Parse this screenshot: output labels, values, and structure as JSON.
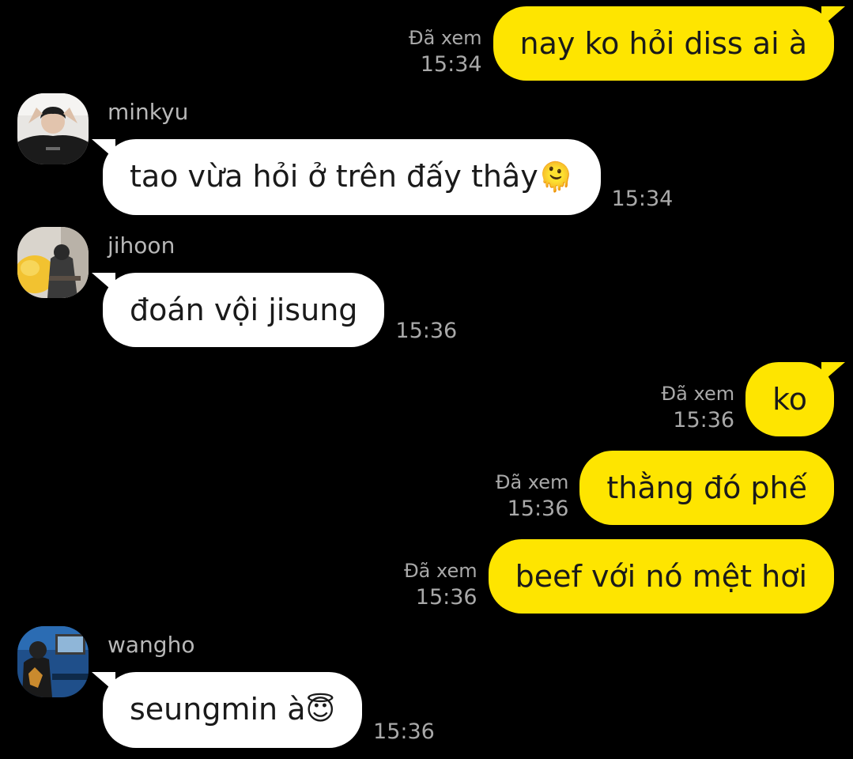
{
  "messages": {
    "m1": {
      "text": "nay ko hỏi diss ai à",
      "read": "Đã xem",
      "time": "15:34"
    },
    "m2": {
      "sender": "minkyu",
      "text": "tao vừa hỏi ở trên đấy thây",
      "emoji": "🫠",
      "emoji_name": "melting-face-emoji",
      "time": "15:34"
    },
    "m3": {
      "sender": "jihoon",
      "text": "đoán vội jisung",
      "time": "15:36"
    },
    "m4": {
      "text": "ko",
      "read": "Đã xem",
      "time": "15:36"
    },
    "m5": {
      "text": "thằng đó phế",
      "read": "Đã xem",
      "time": "15:36"
    },
    "m6": {
      "text": "beef với nó mệt hơi",
      "read": "Đã xem",
      "time": "15:36"
    },
    "m7": {
      "sender": "wangho",
      "text": "seungmin à",
      "emoji": "😇",
      "emoji_name": "smiling-face-with-halo-emoji",
      "time": "15:36"
    }
  },
  "colors": {
    "background": "#000000",
    "outgoing_bubble": "#fee500",
    "incoming_bubble": "#ffffff",
    "meta_text": "#a9a9a9"
  }
}
